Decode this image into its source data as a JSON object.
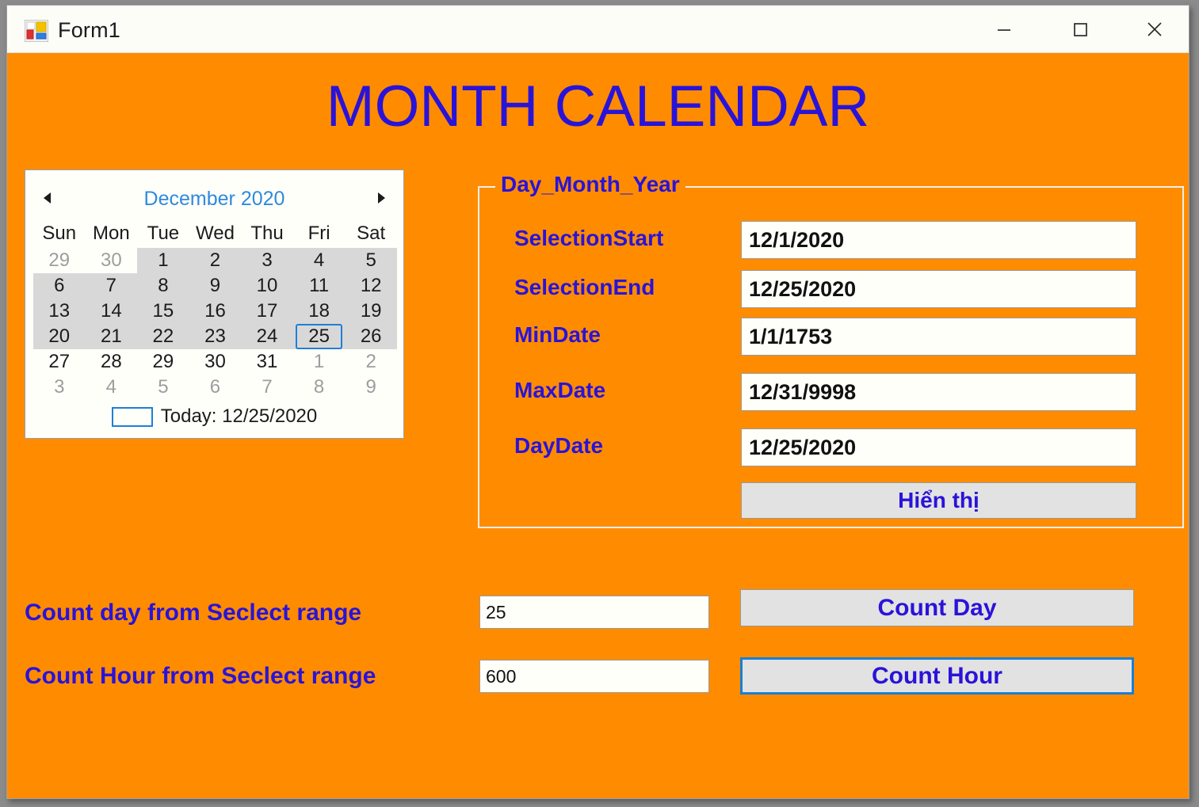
{
  "window": {
    "title": "Form1",
    "icon": "vs-winforms-icon",
    "controls": {
      "minimize": "minimize-icon",
      "maximize": "maximize-icon",
      "close": "close-icon"
    },
    "background_color": "#FF8C00"
  },
  "heading": {
    "text": "MONTH CALENDAR",
    "color": "#2A13D8"
  },
  "calendar": {
    "prev_icon": "triangle-left-icon",
    "next_icon": "triangle-right-icon",
    "month_title": "December 2020",
    "month_title_color": "#2F8ADC",
    "weekdays": [
      "Sun",
      "Mon",
      "Tue",
      "Wed",
      "Thu",
      "Fri",
      "Sat"
    ],
    "weeks": [
      [
        {
          "d": "29",
          "other": true,
          "sel": false,
          "focus": false
        },
        {
          "d": "30",
          "other": true,
          "sel": false,
          "focus": false
        },
        {
          "d": "1",
          "other": false,
          "sel": true,
          "focus": false
        },
        {
          "d": "2",
          "other": false,
          "sel": true,
          "focus": false
        },
        {
          "d": "3",
          "other": false,
          "sel": true,
          "focus": false
        },
        {
          "d": "4",
          "other": false,
          "sel": true,
          "focus": false
        },
        {
          "d": "5",
          "other": false,
          "sel": true,
          "focus": false
        }
      ],
      [
        {
          "d": "6",
          "other": false,
          "sel": true,
          "focus": false
        },
        {
          "d": "7",
          "other": false,
          "sel": true,
          "focus": false
        },
        {
          "d": "8",
          "other": false,
          "sel": true,
          "focus": false
        },
        {
          "d": "9",
          "other": false,
          "sel": true,
          "focus": false
        },
        {
          "d": "10",
          "other": false,
          "sel": true,
          "focus": false
        },
        {
          "d": "11",
          "other": false,
          "sel": true,
          "focus": false
        },
        {
          "d": "12",
          "other": false,
          "sel": true,
          "focus": false
        }
      ],
      [
        {
          "d": "13",
          "other": false,
          "sel": true,
          "focus": false
        },
        {
          "d": "14",
          "other": false,
          "sel": true,
          "focus": false
        },
        {
          "d": "15",
          "other": false,
          "sel": true,
          "focus": false
        },
        {
          "d": "16",
          "other": false,
          "sel": true,
          "focus": false
        },
        {
          "d": "17",
          "other": false,
          "sel": true,
          "focus": false
        },
        {
          "d": "18",
          "other": false,
          "sel": true,
          "focus": false
        },
        {
          "d": "19",
          "other": false,
          "sel": true,
          "focus": false
        }
      ],
      [
        {
          "d": "20",
          "other": false,
          "sel": true,
          "focus": false
        },
        {
          "d": "21",
          "other": false,
          "sel": true,
          "focus": false
        },
        {
          "d": "22",
          "other": false,
          "sel": true,
          "focus": false
        },
        {
          "d": "23",
          "other": false,
          "sel": true,
          "focus": false
        },
        {
          "d": "24",
          "other": false,
          "sel": true,
          "focus": false
        },
        {
          "d": "25",
          "other": false,
          "sel": true,
          "focus": true
        },
        {
          "d": "26",
          "other": false,
          "sel": true,
          "focus": false
        }
      ],
      [
        {
          "d": "27",
          "other": false,
          "sel": false,
          "focus": false
        },
        {
          "d": "28",
          "other": false,
          "sel": false,
          "focus": false
        },
        {
          "d": "29",
          "other": false,
          "sel": false,
          "focus": false
        },
        {
          "d": "30",
          "other": false,
          "sel": false,
          "focus": false
        },
        {
          "d": "31",
          "other": false,
          "sel": false,
          "focus": false
        },
        {
          "d": "1",
          "other": true,
          "sel": false,
          "focus": false
        },
        {
          "d": "2",
          "other": true,
          "sel": false,
          "focus": false
        }
      ],
      [
        {
          "d": "3",
          "other": true,
          "sel": false,
          "focus": false
        },
        {
          "d": "4",
          "other": true,
          "sel": false,
          "focus": false
        },
        {
          "d": "5",
          "other": true,
          "sel": false,
          "focus": false
        },
        {
          "d": "6",
          "other": true,
          "sel": false,
          "focus": false
        },
        {
          "d": "7",
          "other": true,
          "sel": false,
          "focus": false
        },
        {
          "d": "8",
          "other": true,
          "sel": false,
          "focus": false
        },
        {
          "d": "9",
          "other": true,
          "sel": false,
          "focus": false
        }
      ]
    ],
    "today_label": "Today: 12/25/2020",
    "selection_color": "#D8D8D8",
    "focus_color": "#1F7FD6"
  },
  "groupbox": {
    "legend": "Day_Month_Year",
    "rows": [
      {
        "label": "SelectionStart",
        "value": "12/1/2020"
      },
      {
        "label": "SelectionEnd",
        "value": "12/25/2020"
      },
      {
        "label": "MinDate",
        "value": "1/1/1753"
      },
      {
        "label": "MaxDate",
        "value": "12/31/9998"
      },
      {
        "label": "DayDate",
        "value": "12/25/2020"
      }
    ],
    "button_label": "Hiển thị"
  },
  "bottom": {
    "count_day": {
      "label": "Count day from Seclect range",
      "value": "25",
      "button_label": "Count Day",
      "focused": false
    },
    "count_hour": {
      "label": "Count Hour from Seclect range",
      "value": "600",
      "button_label": "Count Hour",
      "focused": true
    }
  }
}
